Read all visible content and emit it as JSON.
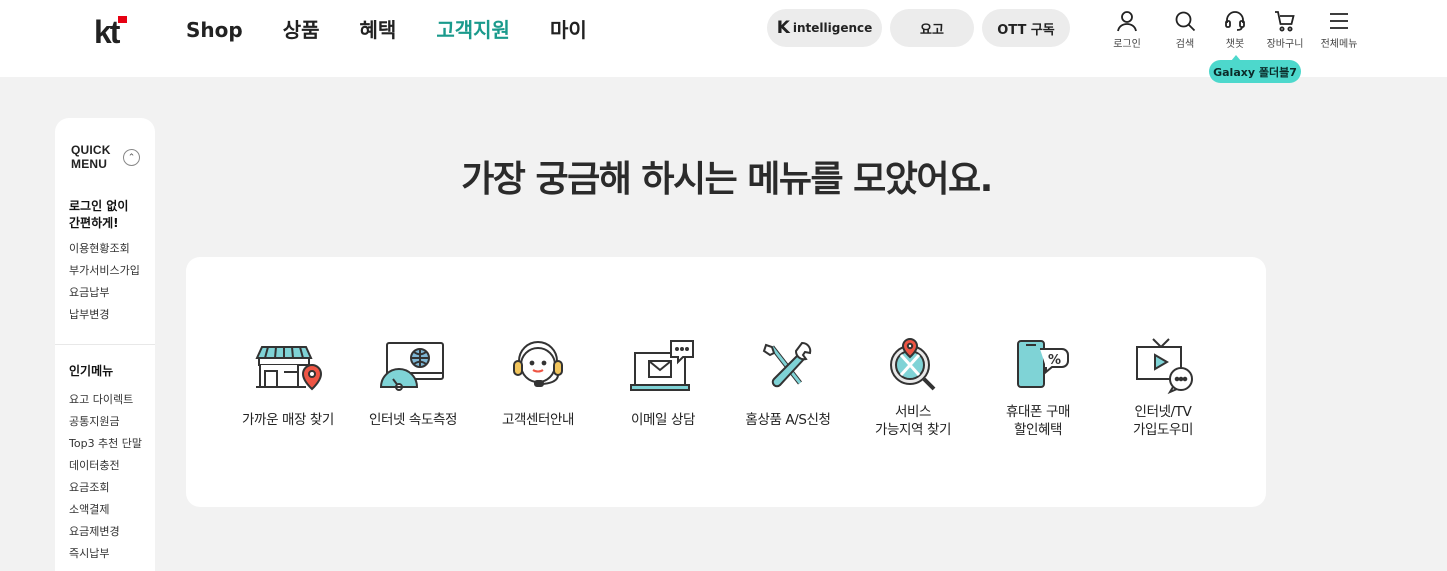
{
  "brand": {
    "logo": "kt",
    "accent": "#1a9a8c",
    "logo_red": "#e60012"
  },
  "gnb": [
    {
      "label": "Shop",
      "active": false
    },
    {
      "label": "상품",
      "active": false
    },
    {
      "label": "혜택",
      "active": false
    },
    {
      "label": "고객지원",
      "active": true
    },
    {
      "label": "마이",
      "active": false
    }
  ],
  "pills": {
    "k_mark": "K",
    "k_text": "intelligence",
    "yogo": "요고",
    "ott": "OTT 구독"
  },
  "util": {
    "login": "로그인",
    "search": "검색",
    "chatbot": "챗봇",
    "cart": "장바구니",
    "all_menu": "전체메뉴"
  },
  "tooltip": "Galaxy 폴더블7",
  "quick_menu": {
    "title_line1": "QUICK",
    "title_line2": "MENU",
    "section1": {
      "title_line1": "로그인 없이",
      "title_line2": "간편하게!",
      "items": [
        "이용현황조회",
        "부가서비스가입",
        "요금납부",
        "납부변경"
      ]
    },
    "section2": {
      "title": "인기메뉴",
      "items": [
        "요고 다이렉트",
        "공통지원금",
        "Top3 추천 단말",
        "데이터충전",
        "요금조회",
        "소액결제",
        "요금제변경",
        "즉시납부"
      ]
    }
  },
  "headline": "가장 궁금해 하시는 메뉴를 모았어요.",
  "menus": [
    {
      "icon": "store-location-icon",
      "line1": "가까운 매장 찾기",
      "line2": ""
    },
    {
      "icon": "speed-test-icon",
      "line1": "인터넷 속도측정",
      "line2": ""
    },
    {
      "icon": "headset-icon",
      "line1": "고객센터안내",
      "line2": ""
    },
    {
      "icon": "email-consult-icon",
      "line1": "이메일 상담",
      "line2": ""
    },
    {
      "icon": "repair-tools-icon",
      "line1": "홈상품 A/S신청",
      "line2": ""
    },
    {
      "icon": "coverage-search-icon",
      "line1": "서비스",
      "line2": "가능지역 찾기"
    },
    {
      "icon": "phone-discount-icon",
      "line1": "휴대폰 구매",
      "line2": "할인혜택"
    },
    {
      "icon": "internet-tv-icon",
      "line1": "인터넷/TV",
      "line2": "가입도우미"
    }
  ]
}
